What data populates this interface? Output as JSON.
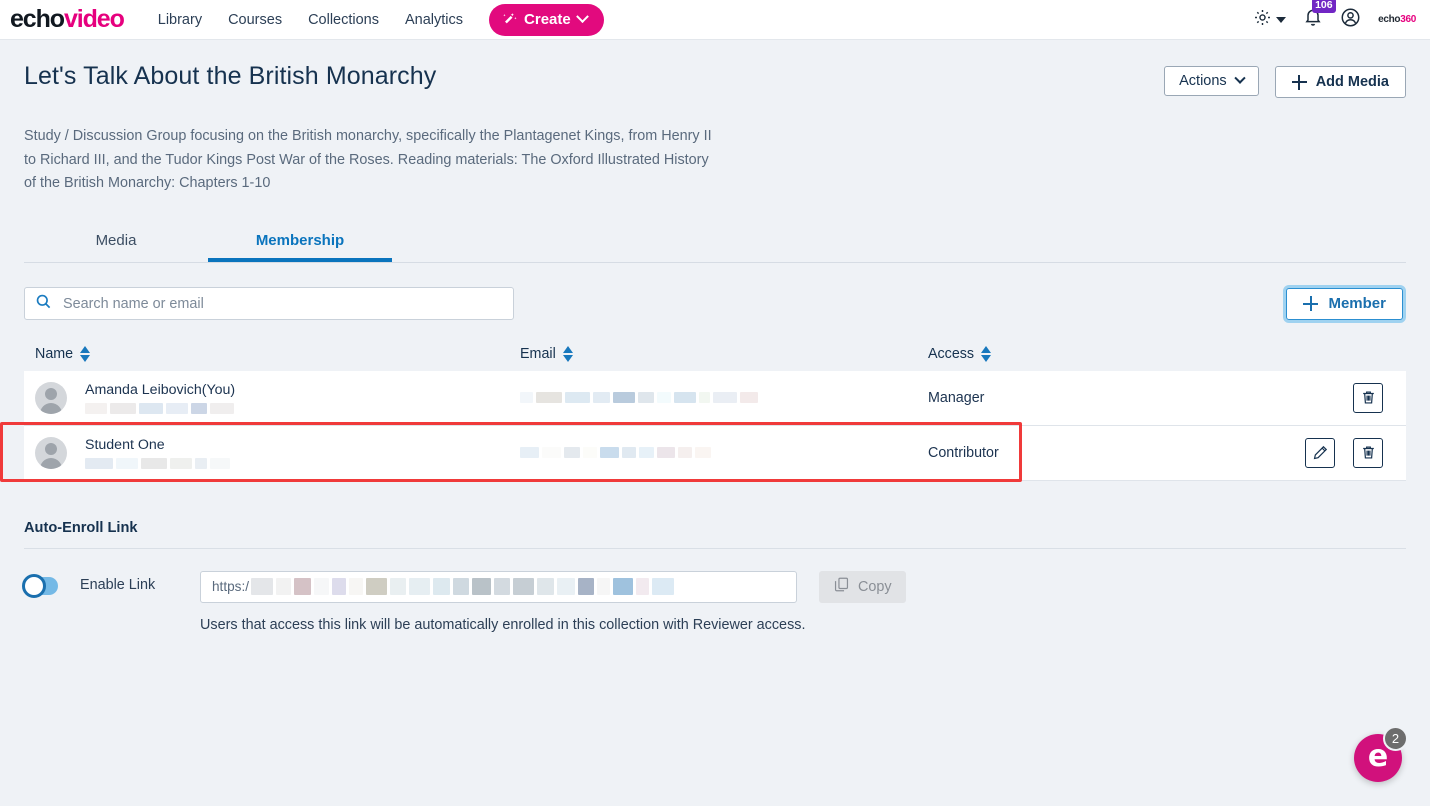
{
  "nav": {
    "logo_echo": "echo",
    "logo_video": "video",
    "links": [
      {
        "label": "Library"
      },
      {
        "label": "Courses"
      },
      {
        "label": "Collections"
      },
      {
        "label": "Analytics"
      }
    ],
    "create_label": "Create",
    "notification_count": "106",
    "brand_right_a": "echo",
    "brand_right_b": "360"
  },
  "header": {
    "title": "Let's Talk About the British Monarchy",
    "description": "Study / Discussion Group focusing on the British monarchy, specifically the Plantagenet Kings, from Henry II to Richard III, and the Tudor Kings Post War of the Roses. Reading materials: The Oxford Illustrated History of the British Monarchy: Chapters 1-10",
    "actions_label": "Actions",
    "add_media_label": "Add Media"
  },
  "tabs": [
    {
      "label": "Media",
      "active": false
    },
    {
      "label": "Membership",
      "active": true
    }
  ],
  "toolbar": {
    "search_placeholder": "Search name or email",
    "search_value": "",
    "member_label": "Member"
  },
  "table": {
    "columns": [
      {
        "label": "Name"
      },
      {
        "label": "Email"
      },
      {
        "label": "Access"
      }
    ],
    "rows": [
      {
        "name": "Amanda Leibovich(You)",
        "name_secondary_redacted": true,
        "email_redacted": true,
        "access": "Manager",
        "has_edit": false,
        "has_delete": true,
        "highlighted": false
      },
      {
        "name": "Student One",
        "name_secondary_redacted": true,
        "email_redacted": true,
        "access": "Contributor",
        "has_edit": true,
        "has_delete": true,
        "highlighted": true
      }
    ]
  },
  "auto_enroll": {
    "section_title": "Auto-Enroll Link",
    "toggle_enabled": true,
    "enable_label": "Enable Link",
    "link_prefix": "https:/",
    "link_redacted": true,
    "copy_label": "Copy",
    "copy_disabled": true,
    "hint": "Users that access this link will be automatically enrolled in this collection with Reviewer access."
  },
  "chat": {
    "logo_letter": "e",
    "unread": "2"
  },
  "colors": {
    "page_bg": "#eff2f6",
    "brand_pink": "#e20a7e",
    "accent_blue": "#0a74bd",
    "text_dark": "#16324f",
    "highlight_red": "#f03a3a",
    "badge_purple": "#7126c4"
  }
}
